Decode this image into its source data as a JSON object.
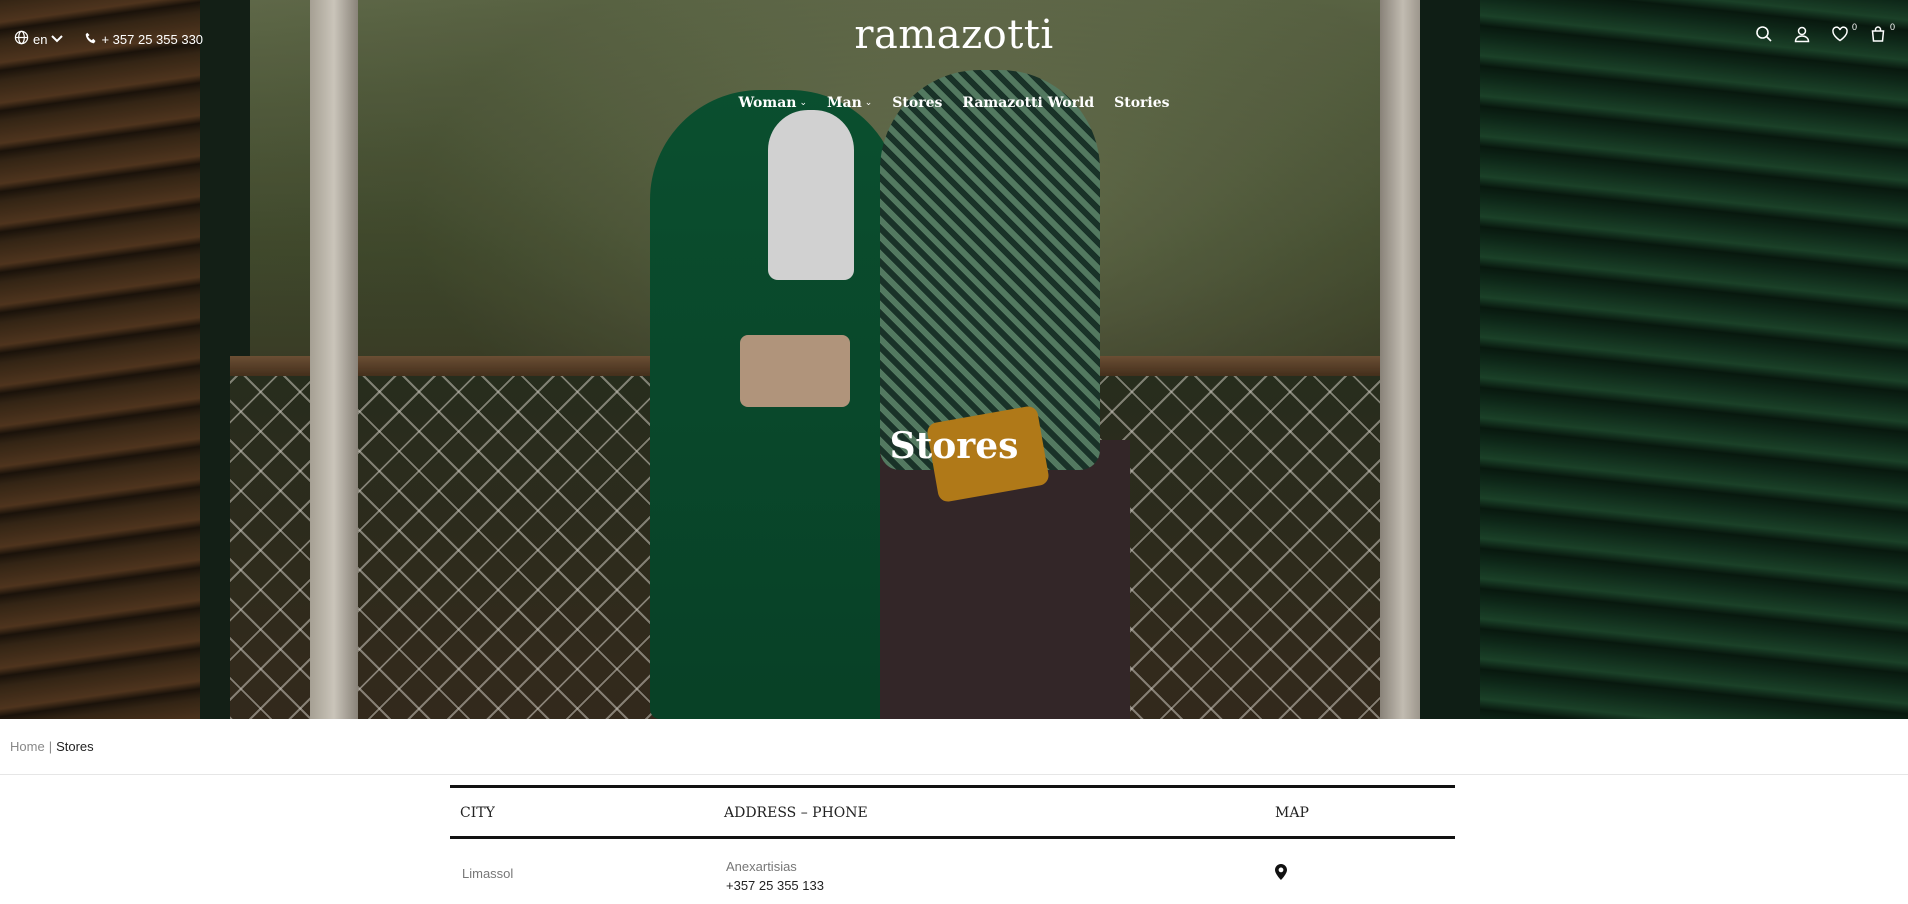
{
  "header": {
    "language": "en",
    "phone": "+ 357 25 355 330",
    "logo": "ramazotti",
    "icons": [
      "globe-icon",
      "chevron-down-icon",
      "phone-icon",
      "search-icon",
      "user-icon",
      "heart-icon",
      "bag-icon"
    ],
    "wishlist_count": "0",
    "cart_count": "0"
  },
  "nav": {
    "items": [
      {
        "label": "Woman",
        "has_dropdown": true
      },
      {
        "label": "Man",
        "has_dropdown": true
      },
      {
        "label": "Stores",
        "has_dropdown": false
      },
      {
        "label": "Ramazotti World",
        "has_dropdown": false
      },
      {
        "label": "Stories",
        "has_dropdown": false
      }
    ]
  },
  "hero": {
    "title": "Stores"
  },
  "breadcrumb": {
    "home": "Home",
    "separator": "|",
    "current": "Stores"
  },
  "stores_table": {
    "headers": {
      "city": "CITY",
      "address_phone": "ADDRESS – PHONE",
      "map": "MAP"
    },
    "rows": [
      {
        "city": "Limassol",
        "address": "Anexartisias",
        "phone": "+357 25 355 133",
        "map_icon": "map-pin-icon"
      }
    ]
  },
  "colors": {
    "text_dark": "#222222",
    "text_muted": "#777777",
    "rule": "#111111",
    "white": "#ffffff"
  }
}
